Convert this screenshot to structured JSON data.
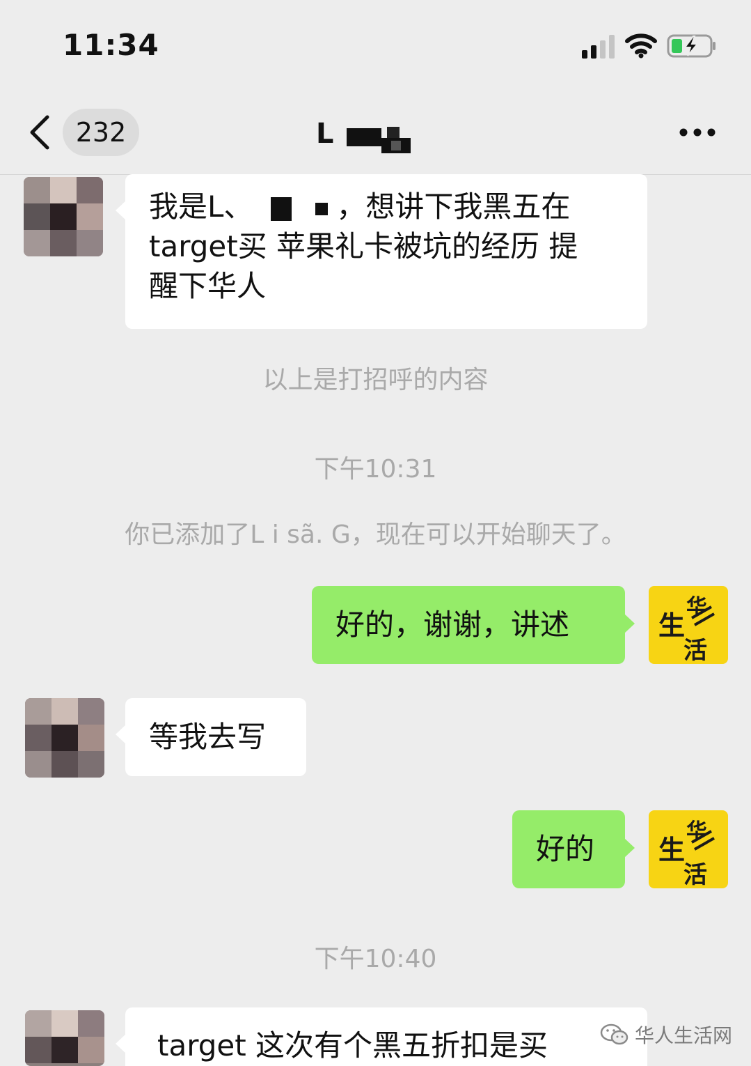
{
  "status_bar": {
    "time": "11:34"
  },
  "nav": {
    "unread_count": "232",
    "title": "L"
  },
  "messages": {
    "m1": {
      "text_part1": "我是L、",
      "text_part2": "，想讲下我黑五在",
      "text_line2": "target买 苹果礼卡被坑的经历 提",
      "text_line3": "醒下华人"
    },
    "sys1": "以上是打招呼的内容",
    "time1": "下午10:31",
    "sys2": "你已添加了L i sã. G，现在可以开始聊天了。",
    "m2": {
      "text": "好的，谢谢，讲述"
    },
    "m3": {
      "text": "等我去写"
    },
    "m4": {
      "text": "好的"
    },
    "time2": "下午10:40",
    "m5": {
      "text": "target 这次有个黑五折扣是买"
    }
  },
  "watermark": {
    "text": "华人生活网"
  },
  "colors": {
    "background": "#ededed",
    "bubble_green": "#95ec69",
    "bubble_white": "#ffffff",
    "avatar_yellow": "#f7d414",
    "system_text": "#a9a9a9"
  },
  "icons": [
    "back-arrow-icon",
    "more-icon",
    "signal-icon",
    "wifi-icon",
    "battery-charging-icon",
    "wechat-icon"
  ]
}
